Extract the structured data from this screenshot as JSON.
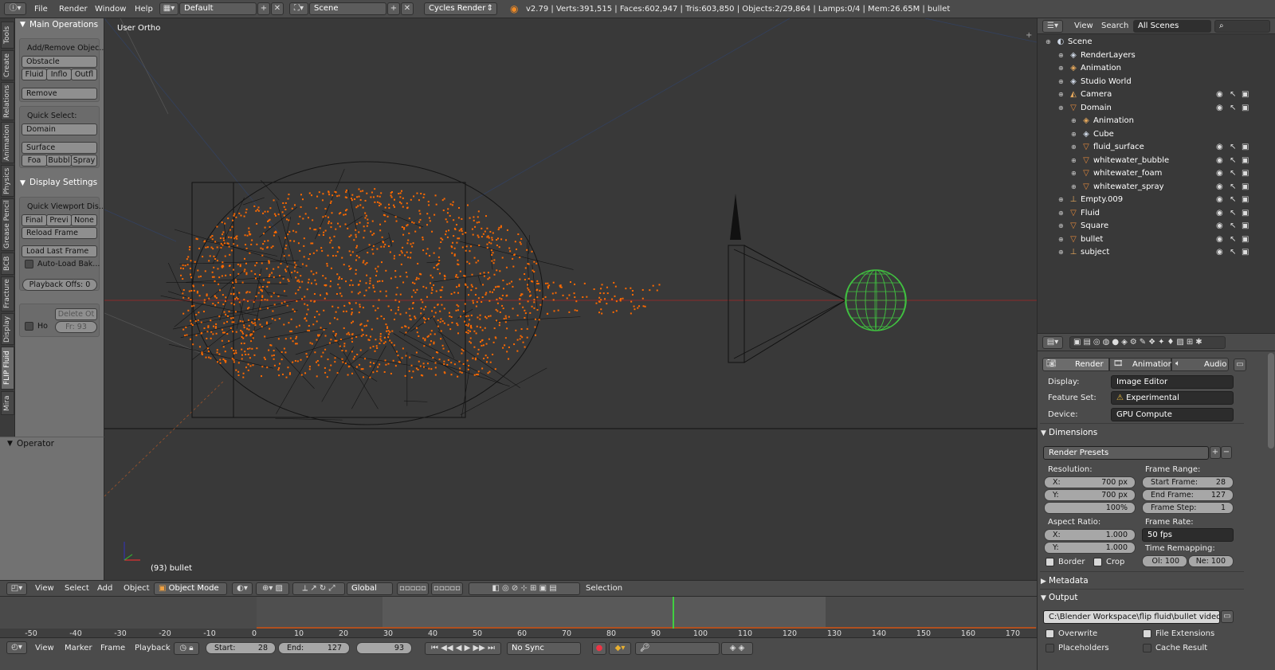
{
  "topbar": {
    "menus": [
      "File",
      "Render",
      "Window",
      "Help"
    ],
    "layout": "Default",
    "scene": "Scene",
    "engine": "Cycles Render",
    "stats": "v2.79 | Verts:391,515 | Faces:602,947 | Tris:603,850 | Objects:2/29,864 | Lamps:0/4 | Mem:26.65M | bullet"
  },
  "tabs": [
    "Tools",
    "Create",
    "Relations",
    "Animation",
    "Physics",
    "Grease Pencil",
    "BCB",
    "Fracture",
    "Display",
    "FLIP Fluid",
    "Mira"
  ],
  "toolshelf": {
    "main_ops_title": "Main Operations",
    "add_remove": "Add/Remove Objec...",
    "obstacle": "Obstacle",
    "fluid": "Fluid",
    "inflow": "Inflo",
    "outflow": "Outfl",
    "remove": "Remove",
    "quick_select_label": "Quick Select:",
    "domain": "Domain",
    "surface": "Surface",
    "foam": "Foa",
    "bubble": "Bubbl",
    "spray": "Spray",
    "display_title": "Display Settings",
    "quick_viewport": "Quick Viewport Dis...",
    "final": "Final",
    "preview": "Previ",
    "none": "None",
    "reload_frame": "Reload Frame",
    "load_last": "Load Last Frame",
    "auto_load": "Auto-Load Bak...",
    "playback": "Playback Offs: 0",
    "delete": "Delete Ot",
    "ho": "Ho",
    "fr": "Fr: 93",
    "operator_title": "Operator"
  },
  "viewport": {
    "view_label": "User Ortho",
    "object_label": "(93) bullet"
  },
  "vpheader": {
    "view": "View",
    "select": "Select",
    "add": "Add",
    "object": "Object",
    "mode": "Object Mode",
    "orientation": "Global",
    "selection": "Selection"
  },
  "timeline": {
    "ticks": [
      "-50",
      "-40",
      "-30",
      "-20",
      "-10",
      "0",
      "10",
      "20",
      "30",
      "40",
      "50",
      "60",
      "70",
      "80",
      "90",
      "100",
      "110",
      "120",
      "130",
      "140",
      "150",
      "160",
      "170"
    ],
    "current_frame_value": 93,
    "start_value": 28,
    "end_value": 127
  },
  "tlheader": {
    "view": "View",
    "marker": "Marker",
    "frame": "Frame",
    "playback": "Playback",
    "start_label": "Start:",
    "start": "28",
    "end_label": "End:",
    "end": "127",
    "current": "93",
    "sync": "No Sync"
  },
  "outliner": {
    "view": "View",
    "search": "Search",
    "scenes": "All Scenes",
    "rows": [
      {
        "label": "Scene",
        "indent": 0,
        "icon": "scene-icon",
        "color": "#cfd8e6",
        "vis": false
      },
      {
        "label": "RenderLayers",
        "indent": 1,
        "icon": "renderlayer-icon",
        "color": "#cfd8e6",
        "vis": false
      },
      {
        "label": "Animation",
        "indent": 1,
        "icon": "animation-icon",
        "color": "#e5a85c",
        "vis": false
      },
      {
        "label": "Studio World",
        "indent": 1,
        "icon": "world-icon",
        "color": "#cfd8e6",
        "vis": false
      },
      {
        "label": "Camera",
        "indent": 1,
        "icon": "camera-icon",
        "color": "#e5a85c",
        "vis": true
      },
      {
        "label": "Domain",
        "indent": 1,
        "icon": "mesh-icon",
        "color": "#e58a3c",
        "vis": true
      },
      {
        "label": "Animation",
        "indent": 2,
        "icon": "animation-icon",
        "color": "#e5a85c",
        "vis": false
      },
      {
        "label": "Cube",
        "indent": 2,
        "icon": "mesh-data-icon",
        "color": "#cfd8e6",
        "vis": false
      },
      {
        "label": "fluid_surface",
        "indent": 2,
        "icon": "mesh-icon",
        "color": "#e58a3c",
        "vis": true
      },
      {
        "label": "whitewater_bubble",
        "indent": 2,
        "icon": "mesh-icon",
        "color": "#e58a3c",
        "vis": true
      },
      {
        "label": "whitewater_foam",
        "indent": 2,
        "icon": "mesh-icon",
        "color": "#e58a3c",
        "vis": true
      },
      {
        "label": "whitewater_spray",
        "indent": 2,
        "icon": "mesh-icon",
        "color": "#e58a3c",
        "vis": true
      },
      {
        "label": "Empty.009",
        "indent": 1,
        "icon": "empty-icon",
        "color": "#e5a85c",
        "vis": true
      },
      {
        "label": "Fluid",
        "indent": 1,
        "icon": "mesh-icon",
        "color": "#e58a3c",
        "vis": true
      },
      {
        "label": "Square",
        "indent": 1,
        "icon": "mesh-icon",
        "color": "#e58a3c",
        "vis": true
      },
      {
        "label": "bullet",
        "indent": 1,
        "icon": "mesh-icon",
        "color": "#e58a3c",
        "vis": true
      },
      {
        "label": "subject",
        "indent": 1,
        "icon": "empty-icon",
        "color": "#e5a85c",
        "vis": true
      }
    ]
  },
  "properties": {
    "tab_render": "Render",
    "tab_animation": "Animation",
    "tab_audio": "Audio",
    "display_label": "Display:",
    "display_value": "Image Editor",
    "feature_label": "Feature Set:",
    "feature_value": "Experimental",
    "device_label": "Device:",
    "device_value": "GPU Compute",
    "dimensions_title": "Dimensions",
    "presets": "Render Presets",
    "resolution_label": "Resolution:",
    "res_x_label": "X:",
    "res_x": "700 px",
    "res_y_label": "Y:",
    "res_y": "700 px",
    "res_pct": "100%",
    "frame_range_label": "Frame Range:",
    "start_frame_label": "Start Frame:",
    "start_frame": "28",
    "end_frame_label": "End Frame:",
    "end_frame": "127",
    "frame_step_label": "Frame Step:",
    "frame_step": "1",
    "aspect_label": "Aspect Ratio:",
    "asp_x_label": "X:",
    "asp_x": "1.000",
    "asp_y_label": "Y:",
    "asp_y": "1.000",
    "frame_rate_label": "Frame Rate:",
    "frame_rate": "50 fps",
    "border": "Border",
    "crop": "Crop",
    "time_remap_label": "Time Remapping:",
    "old": "Ol: 100",
    "new": "Ne: 100",
    "metadata_title": "Metadata",
    "output_title": "Output",
    "output_path": "C:\\Blender  Workspace\\flip fluid\\bullet video\\slow ...",
    "overwrite": "Overwrite",
    "file_ext": "File Extensions",
    "placeholders": "Placeholders",
    "cache_result": "Cache Result"
  },
  "colors": {
    "particles": "#ff6a00",
    "sphere": "#40c040",
    "playhead": "#40d040",
    "accent_blue": "#5680c2"
  }
}
